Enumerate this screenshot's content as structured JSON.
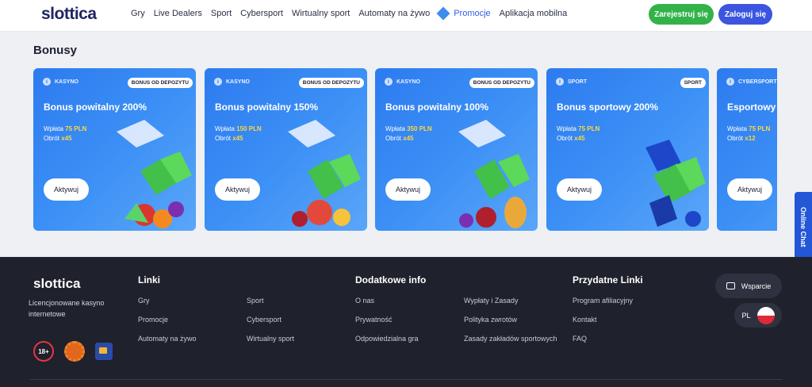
{
  "header": {
    "logo_text": "slottica",
    "nav": [
      "Gry",
      "Live Dealers",
      "Sport",
      "Cybersport",
      "Wirtualny sport",
      "Automaty na żywo",
      "Promocje",
      "Aplikacja mobilna"
    ],
    "register_label": "Zarejestruj się",
    "login_label": "Zaloguj się"
  },
  "section": {
    "title": "Bonusy"
  },
  "cards": [
    {
      "category": "KASYNO",
      "tag": "BONUS OD DEPOZYTU",
      "title": "Bonus powitalny 200%",
      "wager_label": "Wpłata",
      "wager_value": "75 PLN",
      "rollover_label": "Obrót",
      "rollover_value": "x45",
      "button": "Aktywuj"
    },
    {
      "category": "KASYNO",
      "tag": "BONUS OD DEPOZYTU",
      "title": "Bonus powitalny 150%",
      "wager_label": "Wpłata",
      "wager_value": "150 PLN",
      "rollover_label": "Obrót",
      "rollover_value": "x45",
      "button": "Aktywuj"
    },
    {
      "category": "KASYNO",
      "tag": "BONUS OD DEPOZYTU",
      "title": "Bonus powitalny 100%",
      "wager_label": "Wpłata",
      "wager_value": "350 PLN",
      "rollover_label": "Obrót",
      "rollover_value": "x45",
      "button": "Aktywuj"
    },
    {
      "category": "SPORT",
      "tag": "SPORT",
      "title": "Bonus sportowy 200%",
      "wager_label": "Wpłata",
      "wager_value": "75 PLN",
      "rollover_label": "Obrót",
      "rollover_value": "x45",
      "button": "Aktywuj"
    },
    {
      "category": "CYBERSPORT",
      "tag": "",
      "title": "Esportowy",
      "wager_label": "Wpłata",
      "wager_value": "75 PLN",
      "rollover_label": "Obrót",
      "rollover_value": "x12",
      "button": "Aktywuj"
    }
  ],
  "chat_tab": "Online Chat",
  "footer": {
    "logo_text": "slottica",
    "description": "Licencjonowane kasyno internetowe",
    "age_badge": "18+",
    "columns": [
      {
        "heading": "Linki",
        "links": [
          "Gry",
          "Promocje",
          "Automaty na żywo",
          "Sport",
          "Cybersport",
          "Wirtualny sport"
        ]
      },
      {
        "heading": "Dodatkowe info",
        "links": [
          "O nas",
          "Prywatność",
          "Odpowiedzialna gra",
          "Wypłaty i Zasady",
          "Polityka zwrotów",
          "Zasady zakładów sportowych"
        ]
      },
      {
        "heading": "Przydatne Linki",
        "links": [
          "Program afiliacyjny",
          "Kontakt",
          "FAQ"
        ]
      }
    ],
    "support_label": "Wsparcie",
    "language": "PL"
  },
  "colors": {
    "accent_green": "#33b24a",
    "accent_blue": "#3b55e0",
    "card_blue": "#2d7bf0",
    "highlight_yellow": "#ffd83a",
    "footer_bg": "#1f212c"
  }
}
